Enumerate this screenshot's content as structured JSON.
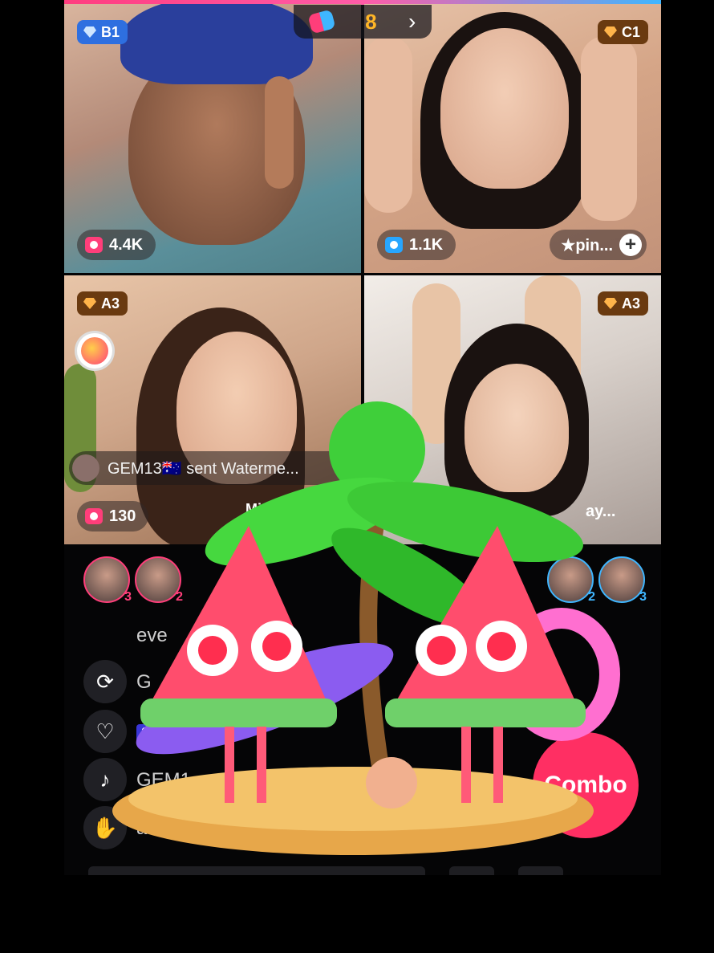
{
  "battle": {
    "score": "8",
    "chevron": "›"
  },
  "tiles": [
    {
      "badge": "B1",
      "count": "4.4K"
    },
    {
      "badge": "C1",
      "count": "1.1K",
      "pill": "★pin...",
      "plus": "+"
    },
    {
      "badge": "A3",
      "count": "130"
    },
    {
      "badge": "A3"
    }
  ],
  "gift_message": "GEM13🇦🇺 sent Waterme...",
  "overlay_texts": {
    "name_left": "MissPr",
    "name_right": "ay..."
  },
  "viewers": [
    {
      "rank": "3"
    },
    {
      "rank": "2"
    },
    {
      "rank": "2"
    },
    {
      "rank": "3"
    }
  ],
  "chat": [
    {
      "text": "eve"
    },
    {
      "text": "G"
    },
    {
      "level": "37",
      "text": "liked the"
    },
    {
      "text": "GEM1"
    },
    {
      "text": "a197"
    }
  ],
  "side_icons": {
    "repost": "⟳",
    "like": "♡",
    "tiktok": "♪",
    "wave": "✋"
  },
  "combo_label": "Combo"
}
